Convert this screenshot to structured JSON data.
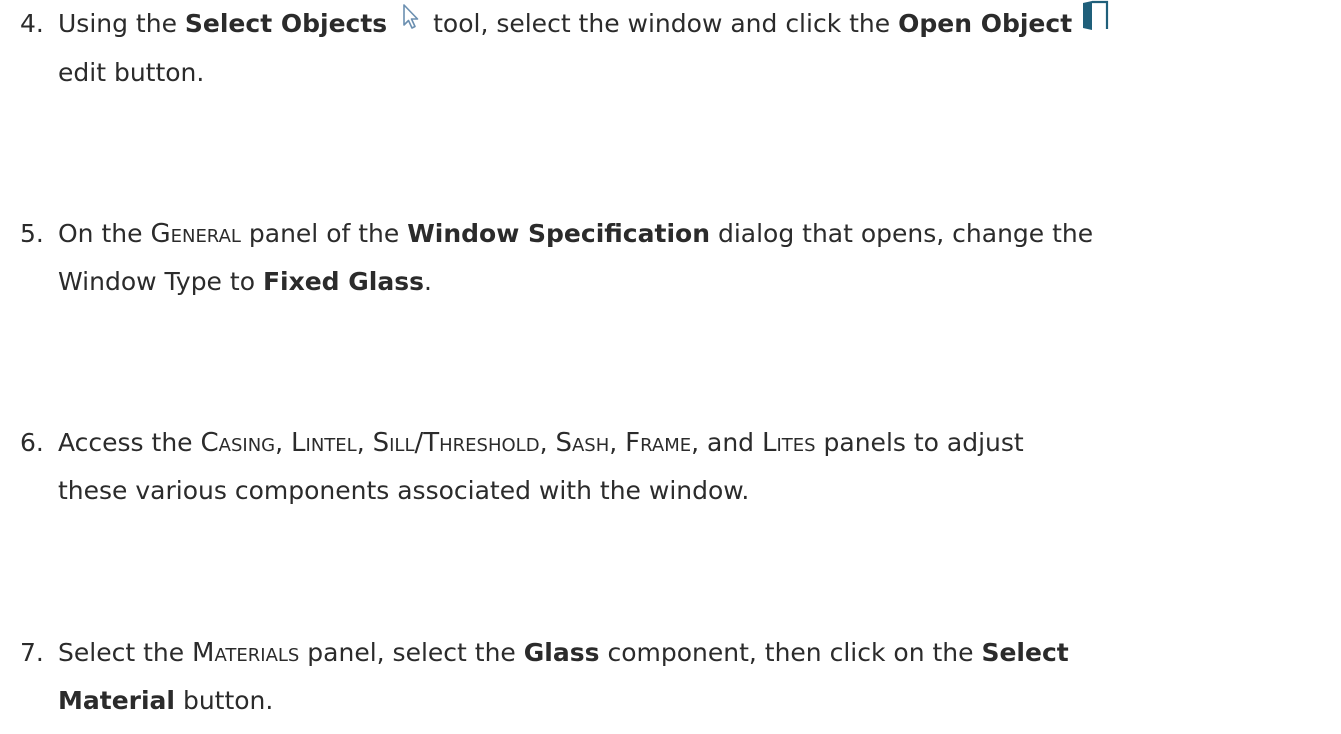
{
  "steps": [
    {
      "number": "4.",
      "t1": "Using the ",
      "b1": "Select Objects",
      "icon1": "arrow-cursor-icon",
      "t2": " tool, select the window and click the ",
      "b2": "Open Object",
      "icon2": "open-door-icon",
      "t3": "edit button."
    },
    {
      "number": "5.",
      "t1": "On the ",
      "sc1": "General",
      "t2": " panel of the ",
      "b1": "Window Specification",
      "t3": " dialog that opens, change the",
      "t4": "Window Type to ",
      "b2": "Fixed Glass",
      "t5": "."
    },
    {
      "number": "6.",
      "t1": "Access the ",
      "sc1": "Casing",
      "t2": ", ",
      "sc2": "Lintel",
      "t3": ", ",
      "sc3": "Sill/Threshold",
      "t4": ", ",
      "sc4": "Sash",
      "t5": ", ",
      "sc5": "Frame",
      "t6": ", and ",
      "sc6": "Lites",
      "t7": " panels to adjust",
      "t8": "these various components associated with the window."
    },
    {
      "number": "7.",
      "t1": "Select the ",
      "sc1": "Materials",
      "t2": " panel, select the ",
      "b1": "Glass",
      "t3": " component, then click on the ",
      "b2": "Select",
      "b3": "Material",
      "t4": " button."
    }
  ],
  "colors": {
    "text": "#2b2b2b",
    "icon_door": "#1f5f7a",
    "icon_cursor_outline": "#6b8fb0"
  }
}
